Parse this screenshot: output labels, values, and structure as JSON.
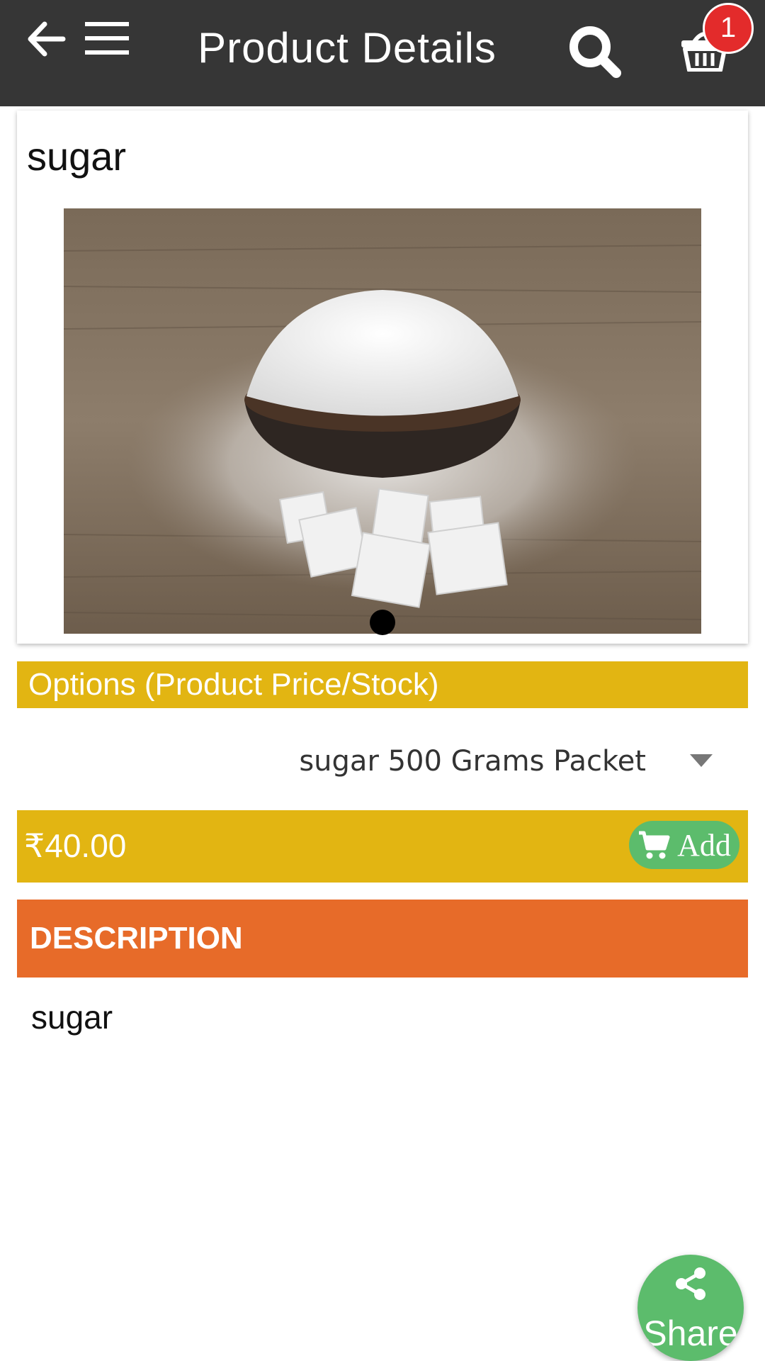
{
  "header": {
    "title": "Product Details",
    "back_icon": "arrow-left-icon",
    "menu_icon": "hamburger-menu-icon",
    "search_icon": "search-icon",
    "cart_icon": "basket-icon",
    "cart_count": "1",
    "background_color": "#363636",
    "badge_color": "#e32b2b"
  },
  "product": {
    "name": "sugar",
    "image_alt": "bowl of white sugar with sugar cubes",
    "carousel": {
      "current": 1,
      "total": 1
    }
  },
  "options": {
    "header_label": "Options (Product Price/Stock)",
    "selected_variant": "sugar 500 Grams Packet",
    "accent_color": "#e2b512"
  },
  "price": {
    "amount": "₹40.00",
    "add_label": "Add",
    "add_icon": "cart-icon",
    "add_color": "#5cbc6c"
  },
  "description": {
    "header_label": "DESCRIPTION",
    "text": "sugar",
    "header_color": "#e76b29"
  },
  "share": {
    "label": "Share",
    "icon": "share-icon"
  }
}
